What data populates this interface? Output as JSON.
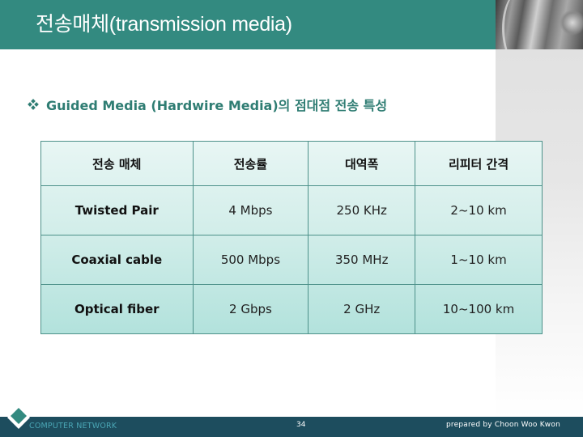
{
  "header": {
    "title": "전송매체(transmission media)"
  },
  "section": {
    "bullet_icon": "diamond-dots-bullet",
    "subtitle": "Guided Media (Hardwire Media)의 점대점 전송 특성"
  },
  "table": {
    "columns": [
      "전송 매체",
      "전송률",
      "대역폭",
      "리피터 간격"
    ],
    "rows": [
      [
        "Twisted Pair",
        "4 Mbps",
        "250 KHz",
        "2~10 km"
      ],
      [
        "Coaxial cable",
        "500 Mbps",
        "350 MHz",
        "1~10 km"
      ],
      [
        "Optical fiber",
        "2 Gbps",
        "2 GHz",
        "10~100 km"
      ]
    ]
  },
  "footer": {
    "logo_icon": "diamond-logo",
    "left_text": "COMPUTER NETWORK",
    "page_number": "34",
    "right_text": "prepared by Choon Woo Kwon"
  },
  "colors": {
    "title_bar": "#338a80",
    "subtitle": "#2f7d73",
    "footer_bar": "#1d4d5e",
    "table_border": "#4d918a"
  }
}
